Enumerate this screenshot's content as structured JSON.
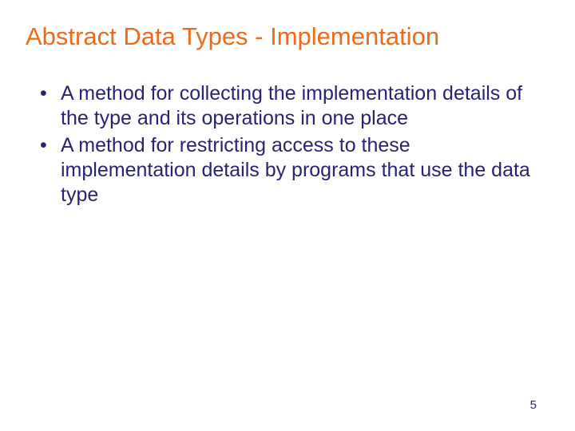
{
  "slide": {
    "title": "Abstract Data Types - Implementation",
    "bullets": [
      "A method for collecting the implementation details of the type and its operations in one place",
      "A method for restricting access to these implementation details by programs that use the data type"
    ],
    "pageNumber": "5"
  }
}
